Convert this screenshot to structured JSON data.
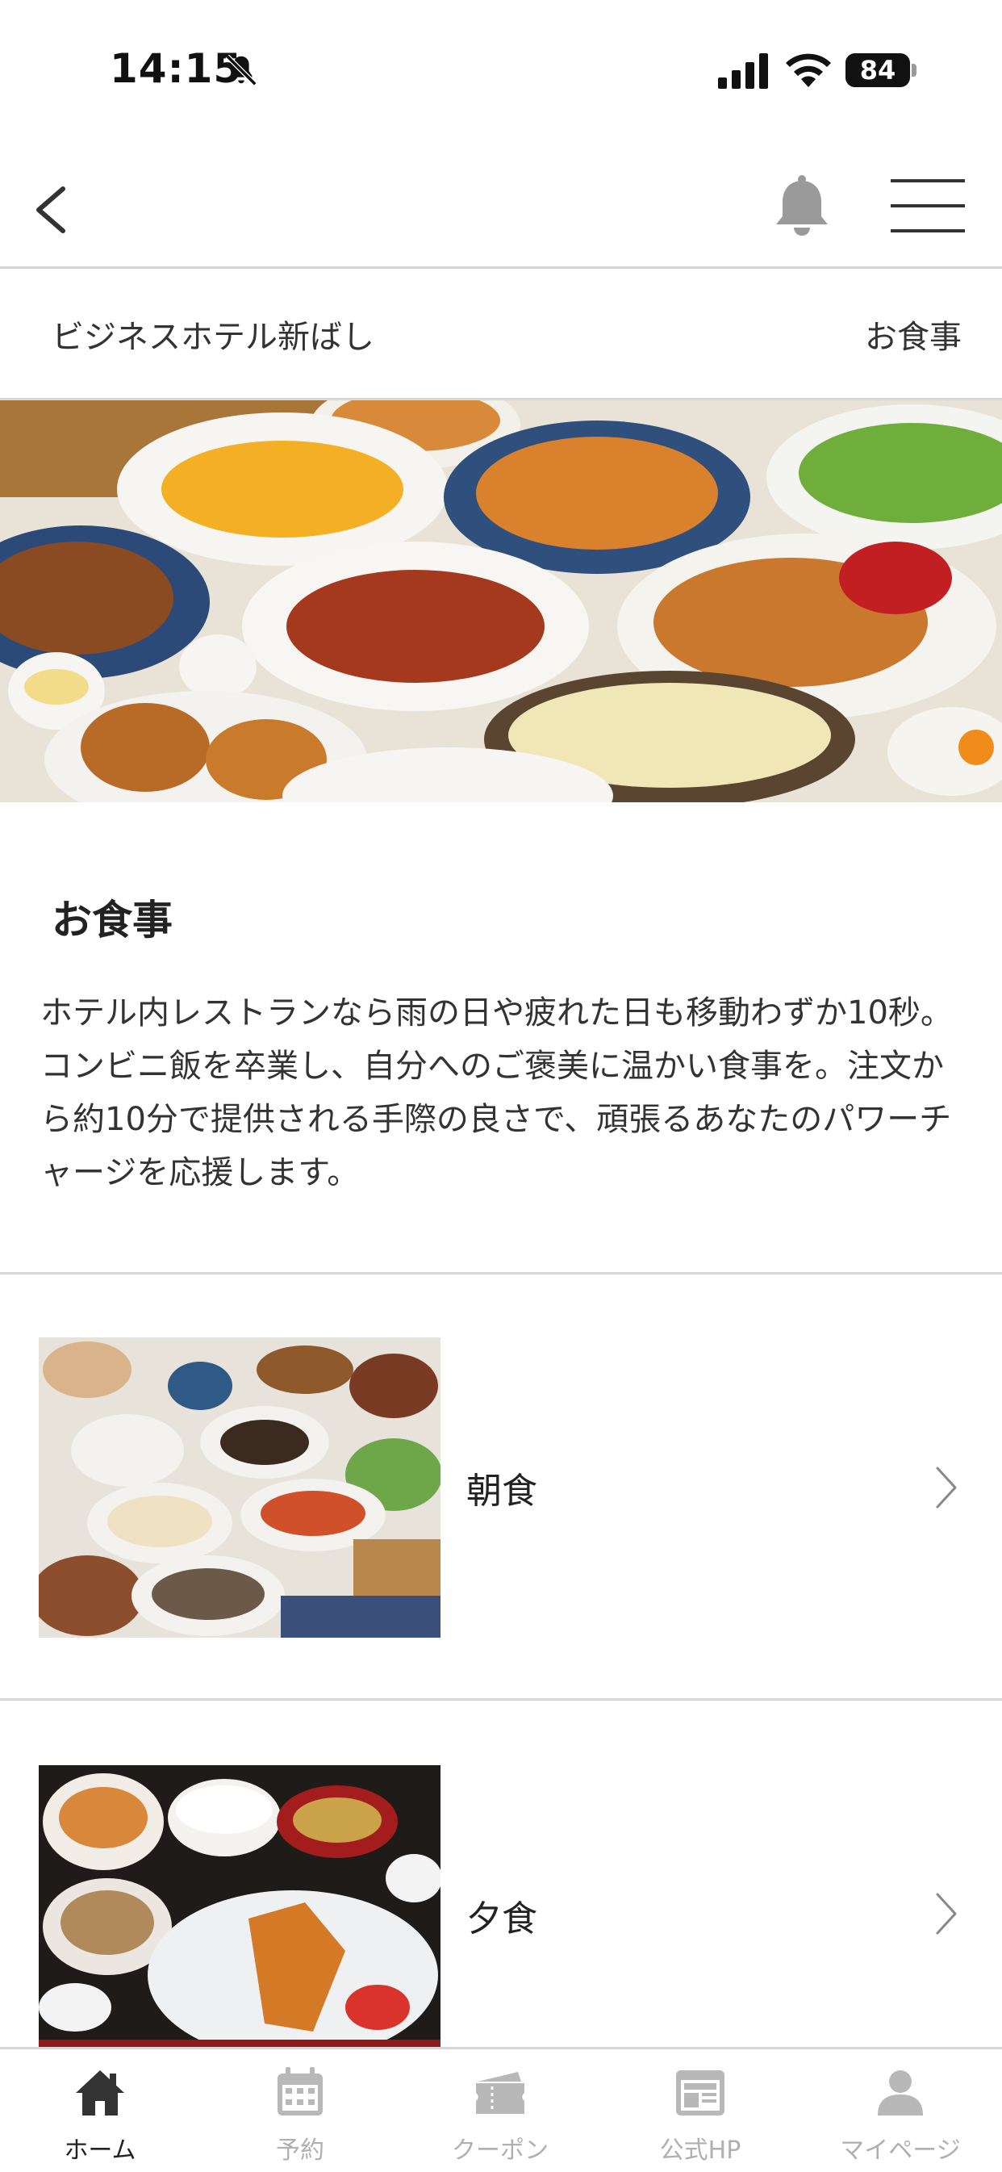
{
  "status_bar": {
    "time": "14:15",
    "battery": "84",
    "battery_level": 0.84
  },
  "header": {
    "breadcrumb_left": "ビジネスホテル新ばし",
    "breadcrumb_right": "お食事"
  },
  "section": {
    "title": "お食事",
    "description": "ホテル内レストランなら雨の日や疲れた日も移動わずか10秒。コンビニ飯を卒業し、自分へのご褒美に温かい食事を。注文から約10分で提供される手際の良さで、頑張るあなたのパワーチャージを応援します。"
  },
  "menu_items": [
    {
      "label": "朝食"
    },
    {
      "label": "夕食"
    }
  ],
  "tabs": [
    {
      "label": "ホーム",
      "icon": "home-icon",
      "active": true
    },
    {
      "label": "予約",
      "icon": "calendar-icon",
      "active": false
    },
    {
      "label": "クーポン",
      "icon": "coupon-icon",
      "active": false
    },
    {
      "label": "公式HP",
      "icon": "website-icon",
      "active": false
    },
    {
      "label": "マイページ",
      "icon": "person-icon",
      "active": false
    }
  ],
  "colors": {
    "active_tab": "#222222",
    "inactive_tab": "#b0b0b0",
    "divider": "#d6d6d6"
  }
}
